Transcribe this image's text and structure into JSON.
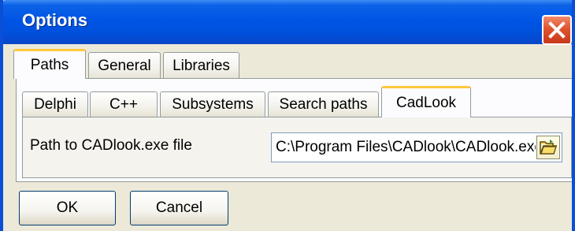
{
  "window": {
    "title": "Options"
  },
  "tabs_main": [
    {
      "label": "Paths",
      "active": true
    },
    {
      "label": "General",
      "active": false
    },
    {
      "label": "Libraries",
      "active": false
    }
  ],
  "tabs_sub": [
    {
      "label": "Delphi",
      "active": false
    },
    {
      "label": "C++",
      "active": false
    },
    {
      "label": "Subsystems",
      "active": false
    },
    {
      "label": "Search paths",
      "active": false
    },
    {
      "label": "CadLook",
      "active": true
    }
  ],
  "cadlook": {
    "path_label": "Path to CADlook.exe file",
    "path_value": "C:\\Program Files\\CADlook\\CADlook.exe"
  },
  "buttons": {
    "ok": "OK",
    "cancel": "Cancel"
  },
  "icons": {
    "close": "close-icon",
    "browse": "folder-open-icon"
  },
  "colors": {
    "titlebar": "#0055e5",
    "active_tab_accent": "#ffc83c",
    "dialog_bg": "#ece9d8"
  }
}
